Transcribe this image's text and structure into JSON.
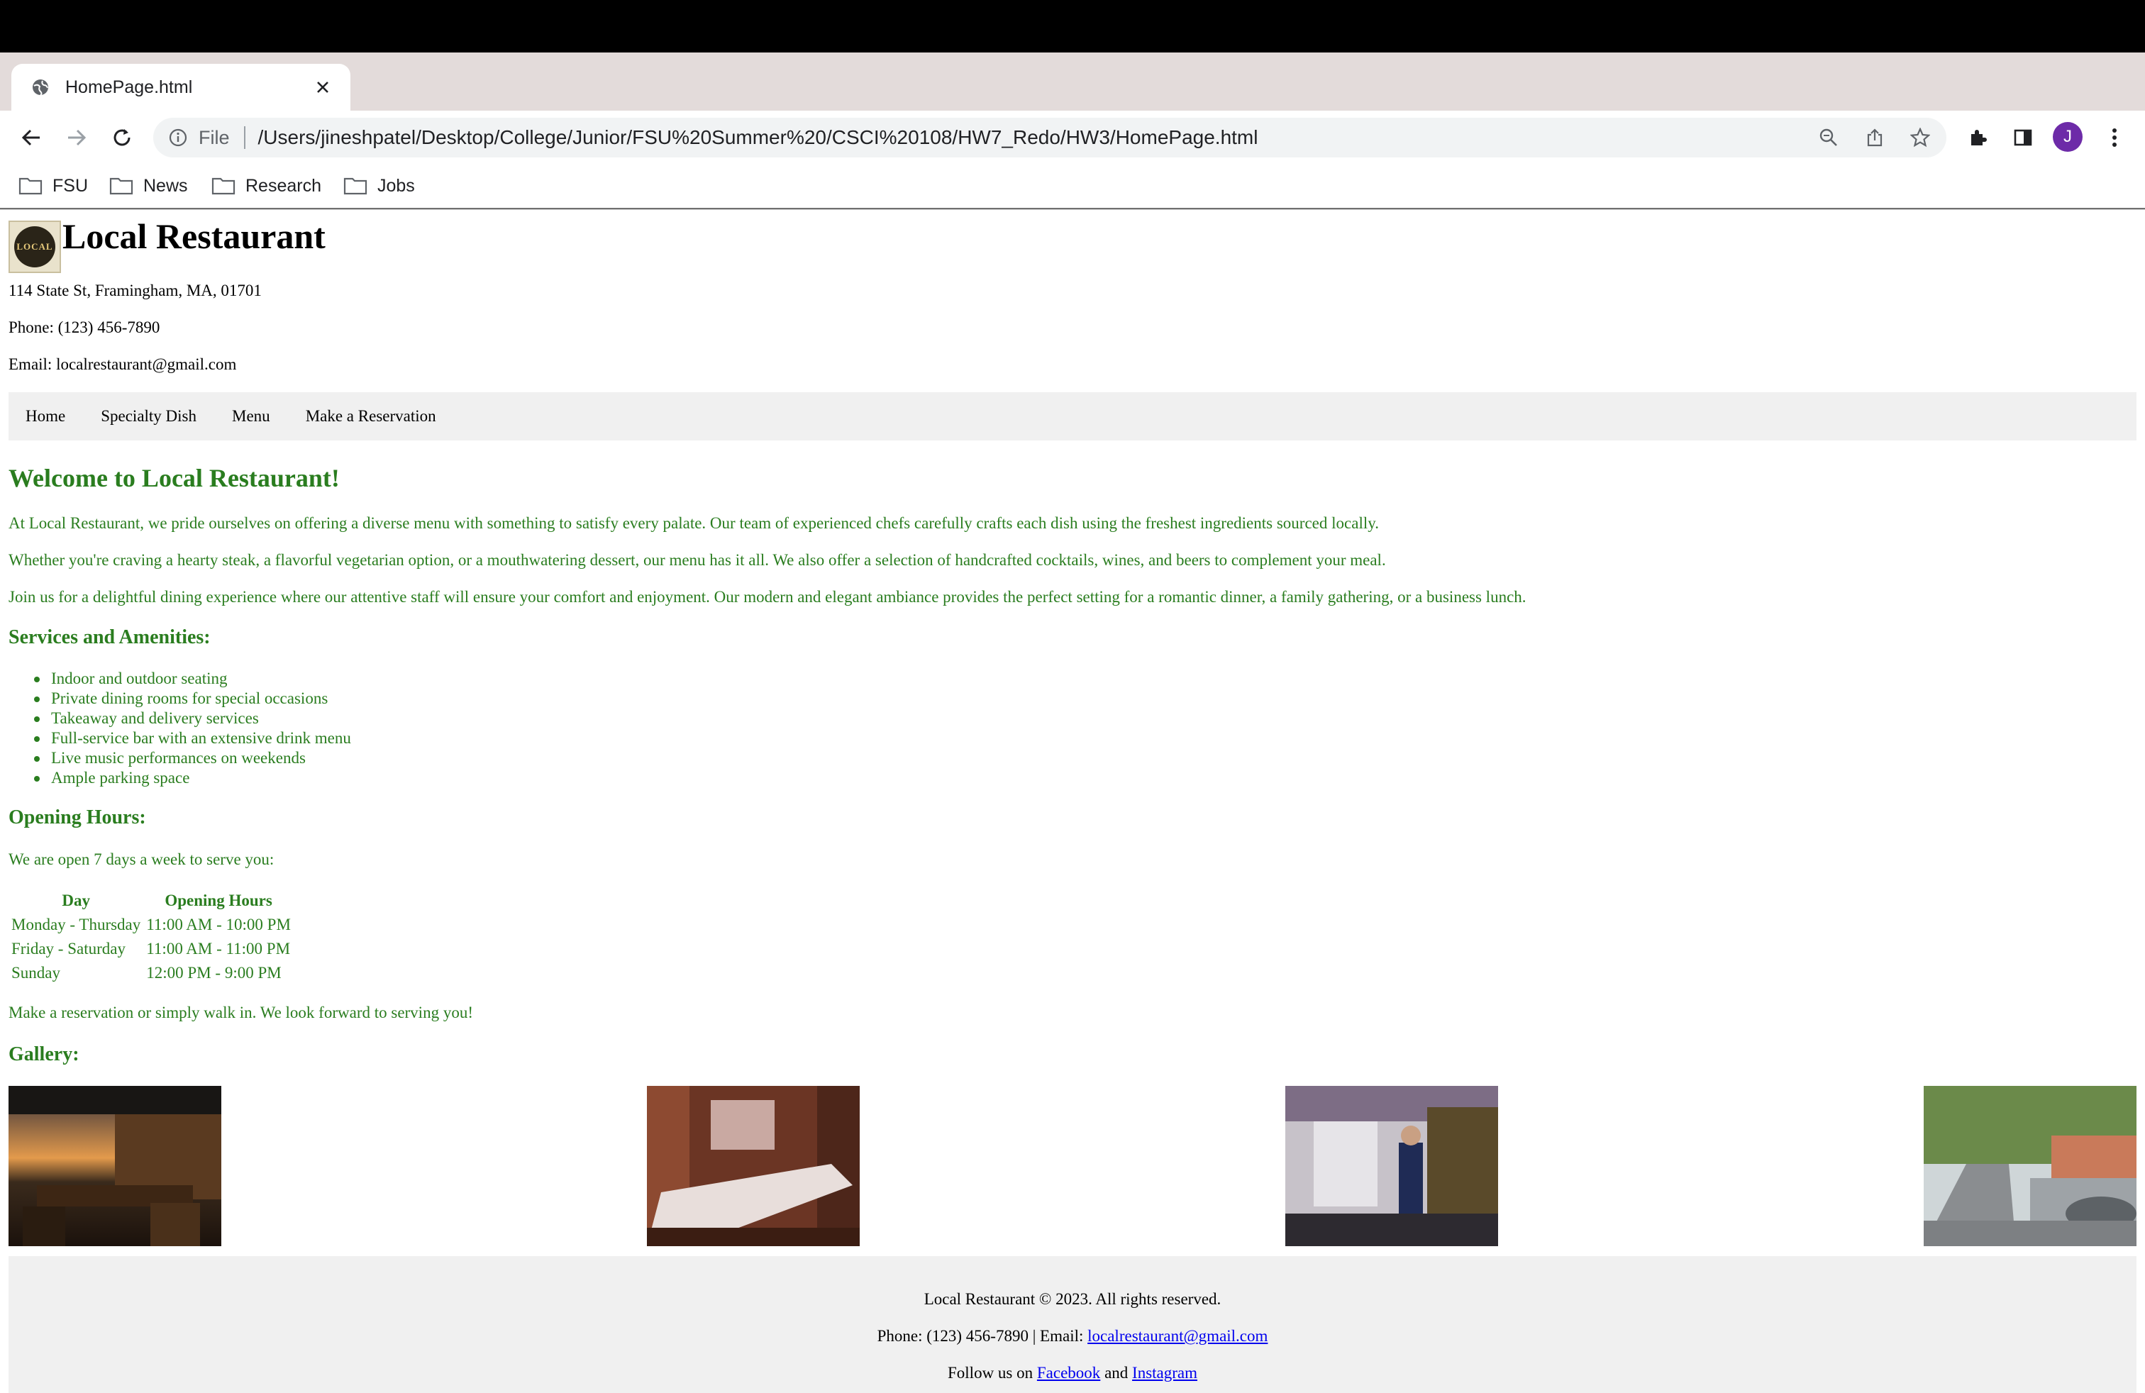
{
  "browser": {
    "tab_title": "HomePage.html",
    "file_label": "File",
    "url": "/Users/jineshpatel/Desktop/College/Junior/FSU%20Summer%20/CSCI%20108/HW7_Redo/HW3/HomePage.html",
    "avatar_letter": "J",
    "bookmarks": [
      "FSU",
      "News",
      "Research",
      "Jobs"
    ]
  },
  "site": {
    "logo_text": "LOCAL",
    "title": "Local Restaurant",
    "address": "114 State St, Framingham, MA, 01701",
    "phone": "Phone: (123) 456-7890",
    "email": "Email: localrestaurant@gmail.com"
  },
  "nav": [
    "Home",
    "Specialty Dish",
    "Menu",
    "Make a Reservation"
  ],
  "welcome": {
    "heading": "Welcome to Local Restaurant!",
    "p1": "At Local Restaurant, we pride ourselves on offering a diverse menu with something to satisfy every palate. Our team of experienced chefs carefully crafts each dish using the freshest ingredients sourced locally.",
    "p2": "Whether you're craving a hearty steak, a flavorful vegetarian option, or a mouthwatering dessert, our menu has it all. We also offer a selection of handcrafted cocktails, wines, and beers to complement your meal.",
    "p3": "Join us for a delightful dining experience where our attentive staff will ensure your comfort and enjoyment. Our modern and elegant ambiance provides the perfect setting for a romantic dinner, a family gathering, or a business lunch."
  },
  "services": {
    "heading": "Services and Amenities:",
    "items": [
      "Indoor and outdoor seating",
      "Private dining rooms for special occasions",
      "Takeaway and delivery services",
      "Full-service bar with an extensive drink menu",
      "Live music performances on weekends",
      "Ample parking space"
    ]
  },
  "hours": {
    "heading": "Opening Hours:",
    "intro": "We are open 7 days a week to serve you:",
    "col_day": "Day",
    "col_hours": "Opening Hours",
    "rows": [
      {
        "day": "Monday - Thursday",
        "time": "11:00 AM - 10:00 PM"
      },
      {
        "day": "Friday - Saturday",
        "time": "11:00 AM - 11:00 PM"
      },
      {
        "day": "Sunday",
        "time": "12:00 PM - 9:00 PM"
      }
    ],
    "outro": "Make a reservation or simply walk in. We look forward to serving you!"
  },
  "gallery": {
    "heading": "Gallery:"
  },
  "footer": {
    "copyright": "Local Restaurant © 2023. All rights reserved.",
    "phone_prefix": "Phone: (123) 456-7890 | Email: ",
    "email_link": "localrestaurant@gmail.com",
    "follow_prefix": "Follow us on ",
    "facebook": "Facebook",
    "and": " and ",
    "instagram": "Instagram"
  }
}
